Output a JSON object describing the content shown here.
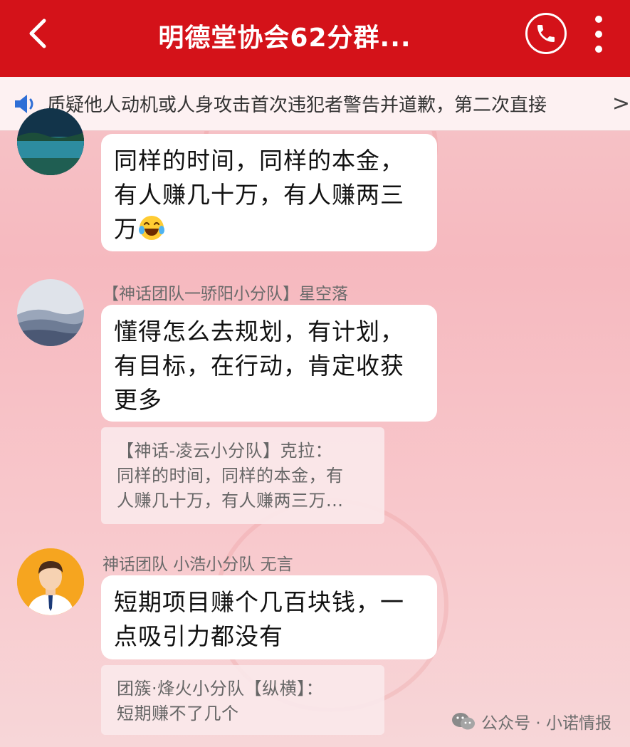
{
  "header": {
    "title": "明德堂协会62分群...",
    "back_icon": "chevron-left-icon",
    "call_icon": "phone-icon",
    "more_icon": "more-vertical-icon",
    "color": "#d41219"
  },
  "notice": {
    "text": "质疑他人动机或人身攻击首次违犯者警告并道歉，第二次直接",
    "icon": "speaker-icon",
    "arrow": ">"
  },
  "messages": [
    {
      "sender": "",
      "text_lines": [
        "同样的时间，同样的本金，",
        "有人赚几十万，有人赚两三",
        "万"
      ],
      "emoji": "laughing-tears-emoji"
    },
    {
      "sender": "【神话团队一骄阳小分队】星空落",
      "text_lines": [
        "懂得怎么去规划，有计划，",
        "有目标，在行动，肯定收获",
        "更多"
      ],
      "quote": {
        "lines": [
          "【神话-凌云小分队】克拉：",
          "同样的时间，同样的本金，有",
          "人赚几十万，有人赚两三万..."
        ]
      }
    },
    {
      "sender": "神话团队 小浩小分队 无言",
      "text_lines": [
        "短期项目赚个几百块钱，一",
        "点吸引力都没有"
      ],
      "quote": {
        "lines": [
          "团簇·烽火小分队【纵横】：",
          "短期赚不了几个"
        ]
      }
    }
  ],
  "footer_watermark": {
    "text": "公众号 · 小诺情报",
    "icon": "wechat-icon"
  }
}
